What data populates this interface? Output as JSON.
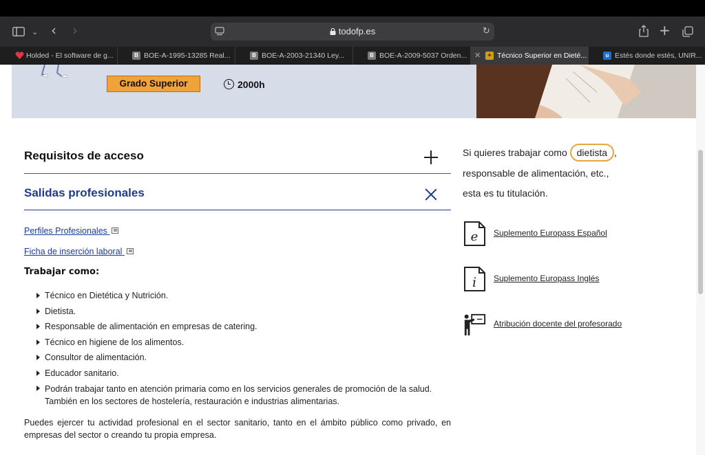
{
  "browser": {
    "url": "todofp.es",
    "tabs": [
      {
        "label": "Holded - El software de g...",
        "favicon": "holded-heart-icon",
        "color": "#e5344a"
      },
      {
        "label": "BOE-A-1995-13285 Real...",
        "favicon": "B",
        "color": "#7a7a7a"
      },
      {
        "label": "BOE-A-2003-21340 Ley...",
        "favicon": "B",
        "color": "#7a7a7a"
      },
      {
        "label": "BOE-A-2009-5037 Orden...",
        "favicon": "B",
        "color": "#7a7a7a"
      },
      {
        "label": "Técnico Superior en Dieté...",
        "favicon": "ministry-icon",
        "color": "#c7a21b",
        "active": true
      },
      {
        "label": "Estés donde estés, UNIR...",
        "favicon": "u",
        "color": "#1f6fd1"
      }
    ]
  },
  "hero": {
    "grade_badge": "Grado Superior",
    "hours": "2000h"
  },
  "accordion": {
    "requisitos": "Requisitos de acceso",
    "salidas": "Salidas profesionales"
  },
  "links": {
    "perfiles": "Perfiles Profesionales",
    "ficha": "Ficha de inserción laboral"
  },
  "trabajar_como": "Trabajar como:",
  "jobs": [
    "Técnico en Dietética y Nutrición.",
    "Dietista.",
    "Responsable de alimentación en empresas de catering.",
    "Técnico en higiene de los alimentos.",
    "Consultor de alimentación.",
    "Educador sanitario.",
    "Podrán trabajar tanto en atención primaria como en los servicios generales de promoción de la salud. También en los sectores de hostelería, restauración e industrias alimentarias."
  ],
  "paragraph": "Puedes ejercer tu actividad profesional en el sector sanitario, tanto en el ámbito público como privado, en empresas del sector o creando tu propia empresa.",
  "right": {
    "line1_prefix": "Si quieres trabajar como",
    "line1_highlight": "dietista",
    "line1_suffix": ",",
    "line2": "responsable de alimentación, etc.,",
    "line3": "esta es tu titulación.",
    "docs": [
      {
        "label": "Suplemento Europass Español",
        "icon": "document-e-icon"
      },
      {
        "label": "Suplemento Europass Inglés",
        "icon": "document-i-icon"
      },
      {
        "label": "Atribución docente del profesorado",
        "icon": "teacher-board-icon"
      }
    ]
  },
  "colors": {
    "accent_blue": "#1d3b8f",
    "badge_orange": "#f0a33a",
    "highlight_orange": "#e8a43d",
    "hero_bg": "#d7dde8"
  }
}
